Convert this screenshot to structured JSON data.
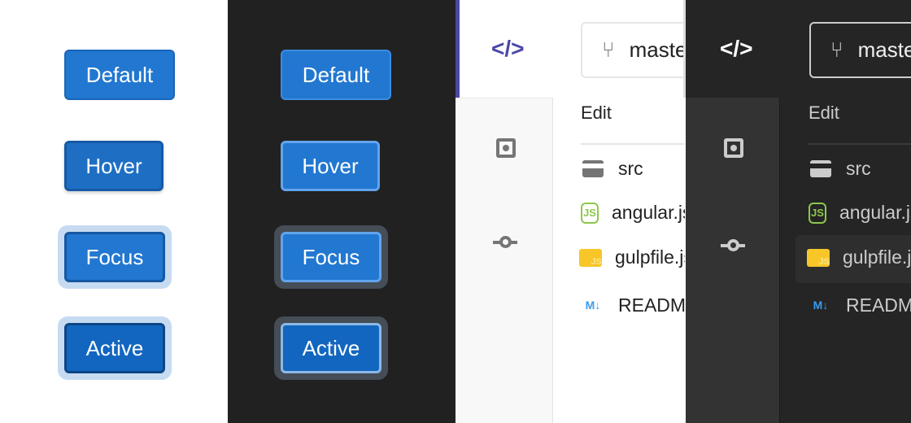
{
  "buttons": {
    "default": "Default",
    "hover": "Hover",
    "focus": "Focus",
    "active": "Active"
  },
  "ide": {
    "branch": "master",
    "edit_label": "Edit",
    "files": [
      {
        "name": "src",
        "icon": "folder-icon"
      },
      {
        "name": "angular.js",
        "icon": "nodejs-icon"
      },
      {
        "name": "gulpfile.js",
        "icon": "js-folder-icon"
      },
      {
        "name": "README.md",
        "icon": "markdown-icon"
      }
    ]
  },
  "colors": {
    "primary": "#2277d0",
    "accent": "#4b48a5",
    "node": "#8cc84b",
    "js": "#f8c629",
    "md": "#3a9bf0"
  }
}
